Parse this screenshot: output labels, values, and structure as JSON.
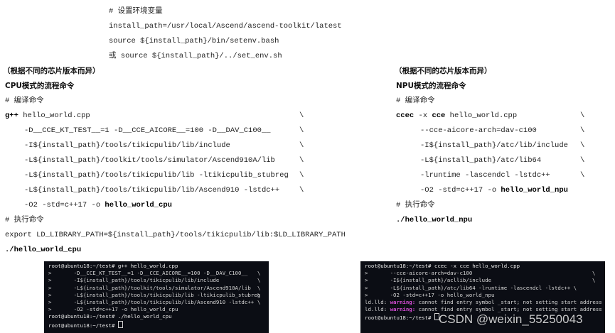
{
  "env": {
    "comment": "# 设置环境变量",
    "line1": "install_path=/usr/local/Ascend/ascend-toolkit/latest",
    "line2": "source ${install_path}/bin/setenv.bash",
    "line3": "或 source ${install_path}/../set_env.sh"
  },
  "left": {
    "note": "（根据不同的芯片版本而异）",
    "title": "CPU模式的流程命令",
    "compile_comment": "# 编译命令",
    "compile_cmd_bold": "g++",
    "compile_cmd_rest": " hello_world.cpp",
    "args": [
      "-D__CCE_KT_TEST__=1 -D__CCE_AICORE__=100 -D__DAV_C100__",
      "-I${install_path}/tools/tikicpulib/lib/include",
      "-L${install_path}/toolkit/tools/simulator/Ascend910A/lib",
      "-L${install_path}/tools/tikicpulib/lib -ltikicpulib_stubreg",
      "-L${install_path}/tools/tikicpulib/lib/Ascend910 -lstdc++"
    ],
    "last_arg_pre": "-O2 -std=c++17 -o ",
    "last_arg_bold": "hello_world_cpu",
    "run_comment": "# 执行命令",
    "export_line": "export LD_LIBRARY_PATH=${install_path}/tools/tikicpulib/lib:$LD_LIBRARY_PATH",
    "run_cmd": "./hello_world_cpu",
    "backslash": "\\"
  },
  "right": {
    "note": "（根据不同的芯片版本而异）",
    "title": "NPU模式的流程命令",
    "compile_comment": "# 编译命令",
    "compile_cmd_bold1": "ccec",
    "compile_cmd_mid": " -x ",
    "compile_cmd_bold2": "cce",
    "compile_cmd_rest": " hello_world.cpp",
    "args": [
      "--cce-aicore-arch=dav-c100",
      "-I${install_path}/atc/lib/include",
      "-L${install_path}/atc/lib64",
      "-lruntime -lascendcl -lstdc++"
    ],
    "last_arg_pre": "-O2 -std=c++17 -o ",
    "last_arg_bold": "hello_world_npu",
    "run_comment": "# 执行命令",
    "run_cmd": "./hello_world_npu",
    "backslash": "\\"
  },
  "terminal_left": {
    "lines": [
      "root@ubuntu18:~/test# g++ hello_world.cpp",
      ">       -D__CCE_KT_TEST__=1 -D__CCE_AICORE__=100 -D__DAV_C100__",
      ">       -I${install_path}/tools/tikicpulib/lib/include",
      ">       -L${install_path}/toolkit/tools/simulator/Ascend910A/lib",
      ">       -L${install_path}/tools/tikicpulib/lib -ltikicpulib_stubreg",
      ">       -L${install_path}/tools/tikicpulib/lib/Ascend910 -lstdc++",
      ">       -O2 -std=c++17 -o hello_world_cpu",
      "root@ubuntu18:~/test# ./hello_world_cpu",
      "root@ubuntu18:~/test# "
    ],
    "bs": "\\"
  },
  "terminal_right": {
    "lines": [
      "root@ubuntu18:~/test# ccec -x cce hello_world.cpp",
      ">       --cce-aicore-arch=dav-c100",
      ">       -I${install_path}/acllib/include",
      ">       -L${install_path}/atc/lib64 -lruntime -lascendcl -lstdc++ \\",
      ">       -O2 -std=c++17 -o hello_world_npu"
    ],
    "warn_prefix": "ld.lld: ",
    "warn_label": "warning:",
    "warn_text": " cannot find entry symbol _start; not setting start address",
    "prompt_last": "root@ubuntu18:~/test# ",
    "bs": "\\"
  },
  "watermark": "CSDN @weixin_55250043"
}
